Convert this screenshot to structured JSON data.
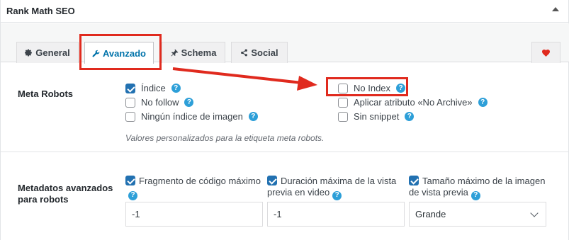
{
  "panel": {
    "title": "Rank Math SEO"
  },
  "tabs": [
    {
      "label": "General",
      "icon": "gear-icon"
    },
    {
      "label": "Avanzado",
      "icon": "wrench-icon",
      "active": true
    },
    {
      "label": "Schema",
      "icon": "pin-icon"
    },
    {
      "label": "Social",
      "icon": "share-icon"
    },
    {
      "label": "",
      "icon": "heart-icon"
    }
  ],
  "meta_robots": {
    "label": "Meta Robots",
    "options": [
      {
        "label": "Índice",
        "checked": true
      },
      {
        "label": "No follow",
        "checked": false
      },
      {
        "label": "Ningún índice de imagen",
        "checked": false
      },
      {
        "label": "No Index",
        "checked": false
      },
      {
        "label": "Aplicar atributo «No Archive»",
        "checked": false
      },
      {
        "label": "Sin snippet",
        "checked": false
      }
    ],
    "description": "Valores personalizados para la etiqueta meta robots."
  },
  "advanced_meta": {
    "label_line1": "Metadatos avanzados",
    "label_line2": "para robots",
    "fields": [
      {
        "label": "Fragmento de código máximo",
        "checked": true,
        "value": "-1"
      },
      {
        "label": "Duración máxima de la vista previa en video",
        "checked": true,
        "value": "-1"
      },
      {
        "label": "Tamaño máximo de la imagen de vista previa",
        "checked": true,
        "value": "Grande"
      }
    ]
  },
  "colors": {
    "accent": "#0073aa",
    "checkbox_checked": "#2271b1",
    "help_icon": "#2d9fd8",
    "annotation_red": "#e02a1e",
    "heart": "#e02a1e"
  }
}
